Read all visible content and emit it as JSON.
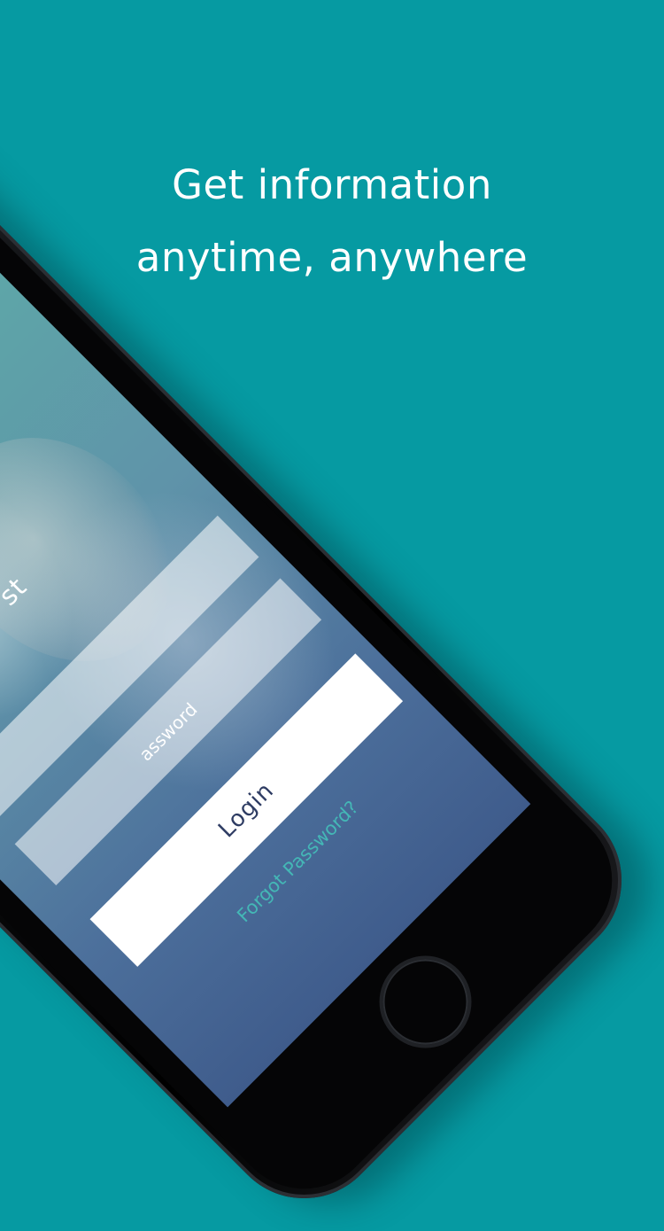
{
  "headline": {
    "line1": "Get information",
    "line2": "anytime, anywhere"
  },
  "colors": {
    "background": "#069aa2",
    "headline_text": "#ffffff",
    "login_text": "#2e3c63",
    "forgot_link": "#44b7b6"
  },
  "phone_screen": {
    "title_fragment": "st",
    "password_placeholder": "assword",
    "login_label": "Login",
    "forgot_password_label": "Forgot Password?"
  }
}
